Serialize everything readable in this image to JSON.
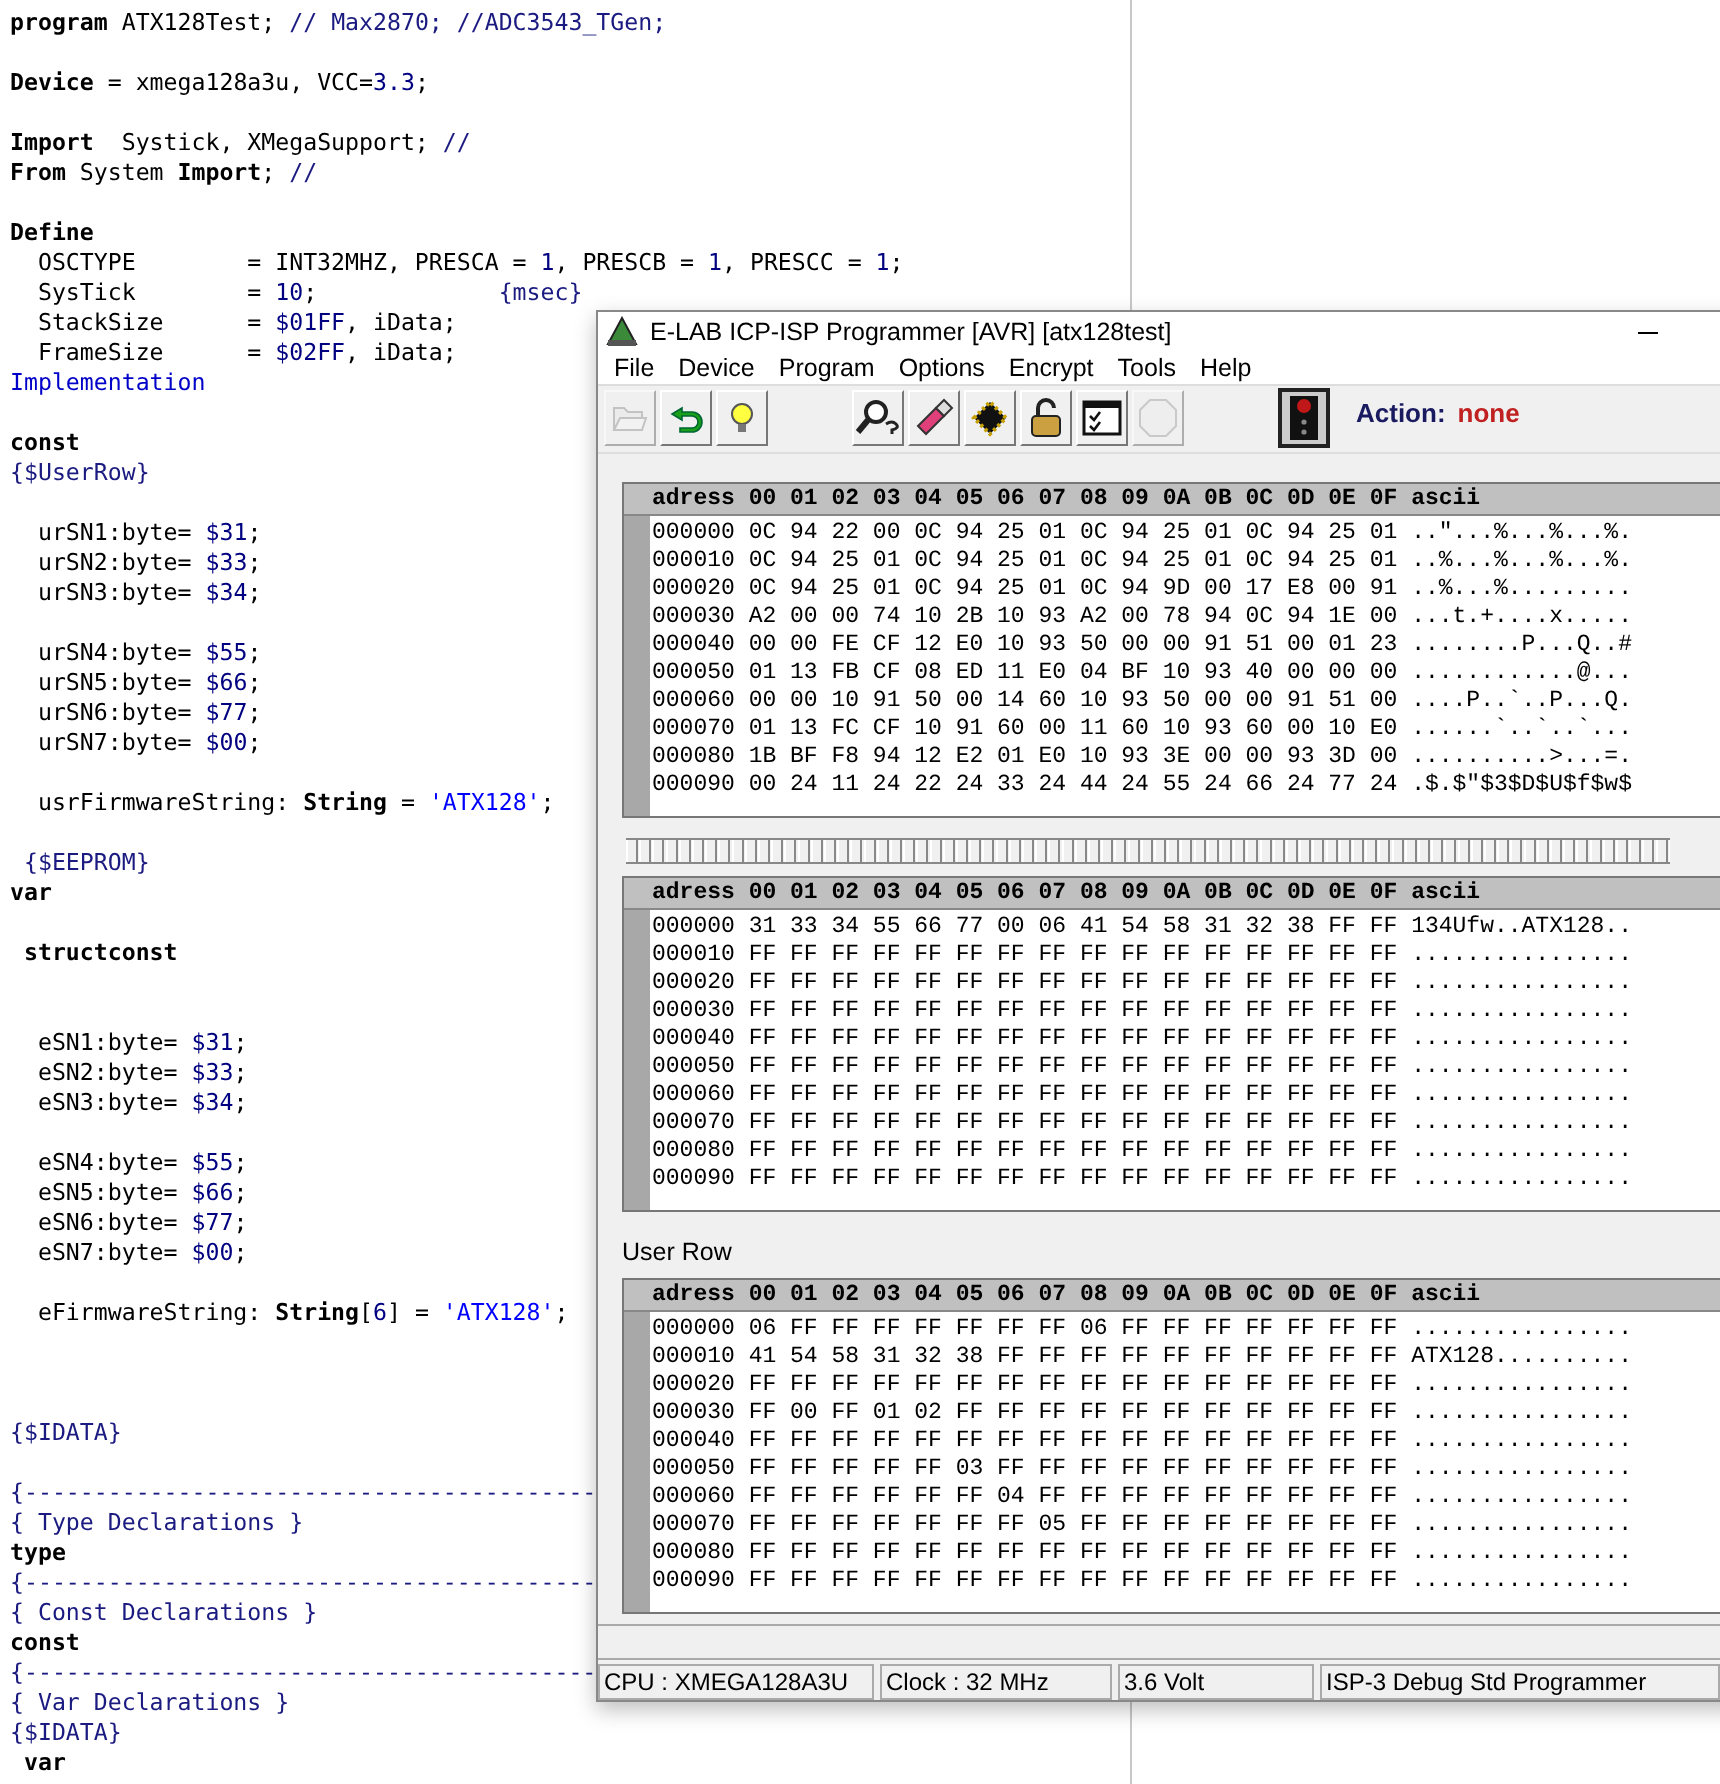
{
  "editor": {
    "lines": [
      {
        "kind": "code",
        "segments": [
          {
            "kind": "kw",
            "text": "program"
          },
          {
            "kind": "plain",
            "text": " ATX128Test; "
          },
          {
            "kind": "comment",
            "text": "// Max2870; //ADC3543_TGen;"
          }
        ]
      },
      {
        "kind": "blank"
      },
      {
        "kind": "code",
        "segments": [
          {
            "kind": "kw",
            "text": "Device"
          },
          {
            "kind": "plain",
            "text": " = xmega128a3u, VCC="
          },
          {
            "kind": "num",
            "text": "3.3"
          },
          {
            "kind": "plain",
            "text": ";"
          }
        ]
      },
      {
        "kind": "blank"
      },
      {
        "kind": "code",
        "segments": [
          {
            "kind": "kw",
            "text": "Import"
          },
          {
            "kind": "plain",
            "text": "  Systick, XMegaSupport; "
          },
          {
            "kind": "comment",
            "text": "//"
          }
        ]
      },
      {
        "kind": "code",
        "segments": [
          {
            "kind": "kw",
            "text": "From"
          },
          {
            "kind": "plain",
            "text": " System "
          },
          {
            "kind": "kw",
            "text": "Import"
          },
          {
            "kind": "plain",
            "text": "; "
          },
          {
            "kind": "comment",
            "text": "//"
          }
        ]
      },
      {
        "kind": "blank"
      },
      {
        "kind": "code",
        "segments": [
          {
            "kind": "kw",
            "text": "Define"
          }
        ]
      },
      {
        "kind": "code",
        "segments": [
          {
            "kind": "plain",
            "text": "  OSCTYPE        = INT32MHZ, PRESCA = "
          },
          {
            "kind": "num",
            "text": "1"
          },
          {
            "kind": "plain",
            "text": ", PRESCB = "
          },
          {
            "kind": "num",
            "text": "1"
          },
          {
            "kind": "plain",
            "text": ", PRESCC = "
          },
          {
            "kind": "num",
            "text": "1"
          },
          {
            "kind": "plain",
            "text": ";"
          }
        ]
      },
      {
        "kind": "code",
        "segments": [
          {
            "kind": "plain",
            "text": "  SysTick        = "
          },
          {
            "kind": "num",
            "text": "10"
          },
          {
            "kind": "plain",
            "text": ";             "
          },
          {
            "kind": "comment",
            "text": "{msec}"
          }
        ]
      },
      {
        "kind": "code",
        "segments": [
          {
            "kind": "plain",
            "text": "  StackSize      = "
          },
          {
            "kind": "num",
            "text": "$01FF"
          },
          {
            "kind": "plain",
            "text": ", iData;"
          }
        ]
      },
      {
        "kind": "code",
        "segments": [
          {
            "kind": "plain",
            "text": "  FrameSize      = "
          },
          {
            "kind": "num",
            "text": "$02FF"
          },
          {
            "kind": "plain",
            "text": ", iData;"
          }
        ]
      },
      {
        "kind": "code",
        "segments": [
          {
            "kind": "dir",
            "text": "Implementation"
          }
        ]
      },
      {
        "kind": "blank"
      },
      {
        "kind": "code",
        "segments": [
          {
            "kind": "kw",
            "text": "const"
          }
        ]
      },
      {
        "kind": "code",
        "segments": [
          {
            "kind": "comment",
            "text": "{$UserRow}"
          }
        ]
      },
      {
        "kind": "blank"
      },
      {
        "kind": "code",
        "segments": [
          {
            "kind": "plain",
            "text": "  urSN1:byte= "
          },
          {
            "kind": "num",
            "text": "$31"
          },
          {
            "kind": "plain",
            "text": ";"
          }
        ]
      },
      {
        "kind": "code",
        "segments": [
          {
            "kind": "plain",
            "text": "  urSN2:byte= "
          },
          {
            "kind": "num",
            "text": "$33"
          },
          {
            "kind": "plain",
            "text": ";"
          }
        ]
      },
      {
        "kind": "code",
        "segments": [
          {
            "kind": "plain",
            "text": "  urSN3:byte= "
          },
          {
            "kind": "num",
            "text": "$34"
          },
          {
            "kind": "plain",
            "text": ";"
          }
        ]
      },
      {
        "kind": "blank"
      },
      {
        "kind": "code",
        "segments": [
          {
            "kind": "plain",
            "text": "  urSN4:byte= "
          },
          {
            "kind": "num",
            "text": "$55"
          },
          {
            "kind": "plain",
            "text": ";"
          }
        ]
      },
      {
        "kind": "code",
        "segments": [
          {
            "kind": "plain",
            "text": "  urSN5:byte= "
          },
          {
            "kind": "num",
            "text": "$66"
          },
          {
            "kind": "plain",
            "text": ";"
          }
        ]
      },
      {
        "kind": "code",
        "segments": [
          {
            "kind": "plain",
            "text": "  urSN6:byte= "
          },
          {
            "kind": "num",
            "text": "$77"
          },
          {
            "kind": "plain",
            "text": ";"
          }
        ]
      },
      {
        "kind": "code",
        "segments": [
          {
            "kind": "plain",
            "text": "  urSN7:byte= "
          },
          {
            "kind": "num",
            "text": "$00"
          },
          {
            "kind": "plain",
            "text": ";"
          }
        ]
      },
      {
        "kind": "blank"
      },
      {
        "kind": "code",
        "segments": [
          {
            "kind": "plain",
            "text": "  usrFirmwareString: "
          },
          {
            "kind": "kw",
            "text": "String"
          },
          {
            "kind": "plain",
            "text": " = "
          },
          {
            "kind": "str",
            "text": "'ATX128'"
          },
          {
            "kind": "plain",
            "text": ";"
          }
        ]
      },
      {
        "kind": "blank"
      },
      {
        "kind": "code",
        "segments": [
          {
            "kind": "comment",
            "text": " {$EEPROM}"
          }
        ]
      },
      {
        "kind": "code",
        "segments": [
          {
            "kind": "kw",
            "text": "var"
          }
        ]
      },
      {
        "kind": "blank"
      },
      {
        "kind": "code",
        "segments": [
          {
            "kind": "kw",
            "text": " structconst"
          }
        ]
      },
      {
        "kind": "blank"
      },
      {
        "kind": "blank"
      },
      {
        "kind": "code",
        "segments": [
          {
            "kind": "plain",
            "text": "  eSN1:byte= "
          },
          {
            "kind": "num",
            "text": "$31"
          },
          {
            "kind": "plain",
            "text": ";"
          }
        ]
      },
      {
        "kind": "code",
        "segments": [
          {
            "kind": "plain",
            "text": "  eSN2:byte= "
          },
          {
            "kind": "num",
            "text": "$33"
          },
          {
            "kind": "plain",
            "text": ";"
          }
        ]
      },
      {
        "kind": "code",
        "segments": [
          {
            "kind": "plain",
            "text": "  eSN3:byte= "
          },
          {
            "kind": "num",
            "text": "$34"
          },
          {
            "kind": "plain",
            "text": ";"
          }
        ]
      },
      {
        "kind": "blank"
      },
      {
        "kind": "code",
        "segments": [
          {
            "kind": "plain",
            "text": "  eSN4:byte= "
          },
          {
            "kind": "num",
            "text": "$55"
          },
          {
            "kind": "plain",
            "text": ";"
          }
        ]
      },
      {
        "kind": "code",
        "segments": [
          {
            "kind": "plain",
            "text": "  eSN5:byte= "
          },
          {
            "kind": "num",
            "text": "$66"
          },
          {
            "kind": "plain",
            "text": ";"
          }
        ]
      },
      {
        "kind": "code",
        "segments": [
          {
            "kind": "plain",
            "text": "  eSN6:byte= "
          },
          {
            "kind": "num",
            "text": "$77"
          },
          {
            "kind": "plain",
            "text": ";"
          }
        ]
      },
      {
        "kind": "code",
        "segments": [
          {
            "kind": "plain",
            "text": "  eSN7:byte= "
          },
          {
            "kind": "num",
            "text": "$00"
          },
          {
            "kind": "plain",
            "text": ";"
          }
        ]
      },
      {
        "kind": "blank"
      },
      {
        "kind": "code",
        "segments": [
          {
            "kind": "plain",
            "text": "  eFirmwareString: "
          },
          {
            "kind": "kw",
            "text": "String"
          },
          {
            "kind": "plain",
            "text": "["
          },
          {
            "kind": "num",
            "text": "6"
          },
          {
            "kind": "plain",
            "text": "] = "
          },
          {
            "kind": "str",
            "text": "'ATX128'"
          },
          {
            "kind": "plain",
            "text": ";"
          }
        ]
      },
      {
        "kind": "blank"
      },
      {
        "kind": "blank"
      },
      {
        "kind": "blank"
      },
      {
        "kind": "code",
        "segments": [
          {
            "kind": "comment",
            "text": "{$IDATA}"
          }
        ]
      },
      {
        "kind": "blank"
      },
      {
        "kind": "code",
        "segments": [
          {
            "kind": "comment",
            "text": "{-----------------------------------------"
          }
        ]
      },
      {
        "kind": "code",
        "segments": [
          {
            "kind": "comment",
            "text": "{ Type Declarations }"
          }
        ]
      },
      {
        "kind": "code",
        "segments": [
          {
            "kind": "kw",
            "text": "type"
          }
        ]
      },
      {
        "kind": "code",
        "segments": [
          {
            "kind": "comment",
            "text": "{-----------------------------------------"
          }
        ]
      },
      {
        "kind": "code",
        "segments": [
          {
            "kind": "comment",
            "text": "{ Const Declarations }"
          }
        ]
      },
      {
        "kind": "code",
        "segments": [
          {
            "kind": "kw",
            "text": "const"
          }
        ]
      },
      {
        "kind": "code",
        "segments": [
          {
            "kind": "comment",
            "text": "{-----------------------------------------"
          }
        ]
      },
      {
        "kind": "code",
        "segments": [
          {
            "kind": "comment",
            "text": "{ Var Declarations }"
          }
        ]
      },
      {
        "kind": "code",
        "segments": [
          {
            "kind": "comment",
            "text": "{$IDATA}"
          }
        ]
      },
      {
        "kind": "code",
        "segments": [
          {
            "kind": "kw",
            "text": " var"
          }
        ]
      }
    ]
  },
  "window": {
    "title": "E-LAB ICP-ISP Programmer [AVR]  [atx128test]",
    "menu": [
      "File",
      "Device",
      "Program",
      "Options",
      "Encrypt",
      "Tools",
      "Help"
    ],
    "toolbar": [
      {
        "kind": "open",
        "disabled": true
      },
      {
        "kind": "undo",
        "disabled": false
      },
      {
        "kind": "bulb",
        "disabled": false
      },
      {
        "kind": "gap"
      },
      {
        "kind": "search",
        "disabled": false
      },
      {
        "kind": "eraser",
        "disabled": false
      },
      {
        "kind": "chip",
        "disabled": false
      },
      {
        "kind": "lock",
        "disabled": false
      },
      {
        "kind": "checklist",
        "disabled": false
      },
      {
        "kind": "stop",
        "disabled": true
      }
    ],
    "action": {
      "label": "Action:",
      "value": "none"
    },
    "panels": [
      {
        "columns": [
          "adress",
          "00",
          "01",
          "02",
          "03",
          "04",
          "05",
          "06",
          "07",
          "08",
          "09",
          "0A",
          "0B",
          "0C",
          "0D",
          "0E",
          "0F",
          "ascii"
        ],
        "rows": [
          {
            "address": "000000",
            "bytes": "0C 94 22 00 0C 94 25 01 0C 94 25 01 0C 94 25 01",
            "ascii": "..\"...%...%...%."
          },
          {
            "address": "000010",
            "bytes": "0C 94 25 01 0C 94 25 01 0C 94 25 01 0C 94 25 01",
            "ascii": "..%...%...%...%."
          },
          {
            "address": "000020",
            "bytes": "0C 94 25 01 0C 94 25 01 0C 94 9D 00 17 E8 00 91",
            "ascii": "..%...%........."
          },
          {
            "address": "000030",
            "bytes": "A2 00 00 74 10 2B 10 93 A2 00 78 94 0C 94 1E 00",
            "ascii": "...t.+....x....."
          },
          {
            "address": "000040",
            "bytes": "00 00 FE CF 12 E0 10 93 50 00 00 91 51 00 01 23",
            "ascii": "........P...Q..#"
          },
          {
            "address": "000050",
            "bytes": "01 13 FB CF 08 ED 11 E0 04 BF 10 93 40 00 00 00",
            "ascii": "............@..."
          },
          {
            "address": "000060",
            "bytes": "00 00 10 91 50 00 14 60 10 93 50 00 00 91 51 00",
            "ascii": "....P..`..P...Q."
          },
          {
            "address": "000070",
            "bytes": "01 13 FC CF 10 91 60 00 11 60 10 93 60 00 10 E0",
            "ascii": "......`..`..`..."
          },
          {
            "address": "000080",
            "bytes": "1B BF F8 94 12 E2 01 E0 10 93 3E 00 00 93 3D 00",
            "ascii": "..........>...=."
          },
          {
            "address": "000090",
            "bytes": "00 24 11 24 22 24 33 24 44 24 55 24 66 24 77 24",
            "ascii": ".$.$\"$3$D$U$f$w$"
          }
        ]
      },
      {
        "columns": [
          "adress",
          "00",
          "01",
          "02",
          "03",
          "04",
          "05",
          "06",
          "07",
          "08",
          "09",
          "0A",
          "0B",
          "0C",
          "0D",
          "0E",
          "0F",
          "ascii"
        ],
        "rows": [
          {
            "address": "000000",
            "bytes": "31 33 34 55 66 77 00 06 41 54 58 31 32 38 FF FF",
            "ascii": "134Ufw..ATX128.."
          },
          {
            "address": "000010",
            "bytes": "FF FF FF FF FF FF FF FF FF FF FF FF FF FF FF FF",
            "ascii": "................"
          },
          {
            "address": "000020",
            "bytes": "FF FF FF FF FF FF FF FF FF FF FF FF FF FF FF FF",
            "ascii": "................"
          },
          {
            "address": "000030",
            "bytes": "FF FF FF FF FF FF FF FF FF FF FF FF FF FF FF FF",
            "ascii": "................"
          },
          {
            "address": "000040",
            "bytes": "FF FF FF FF FF FF FF FF FF FF FF FF FF FF FF FF",
            "ascii": "................"
          },
          {
            "address": "000050",
            "bytes": "FF FF FF FF FF FF FF FF FF FF FF FF FF FF FF FF",
            "ascii": "................"
          },
          {
            "address": "000060",
            "bytes": "FF FF FF FF FF FF FF FF FF FF FF FF FF FF FF FF",
            "ascii": "................"
          },
          {
            "address": "000070",
            "bytes": "FF FF FF FF FF FF FF FF FF FF FF FF FF FF FF FF",
            "ascii": "................"
          },
          {
            "address": "000080",
            "bytes": "FF FF FF FF FF FF FF FF FF FF FF FF FF FF FF FF",
            "ascii": "................"
          },
          {
            "address": "000090",
            "bytes": "FF FF FF FF FF FF FF FF FF FF FF FF FF FF FF FF",
            "ascii": "................"
          }
        ]
      },
      {
        "label": "User Row",
        "columns": [
          "adress",
          "00",
          "01",
          "02",
          "03",
          "04",
          "05",
          "06",
          "07",
          "08",
          "09",
          "0A",
          "0B",
          "0C",
          "0D",
          "0E",
          "0F",
          "ascii"
        ],
        "rows": [
          {
            "address": "000000",
            "bytes": "06 FF FF FF FF FF FF FF 06 FF FF FF FF FF FF FF",
            "ascii": "................"
          },
          {
            "address": "000010",
            "bytes": "41 54 58 31 32 38 FF FF FF FF FF FF FF FF FF FF",
            "ascii": "ATX128.........."
          },
          {
            "address": "000020",
            "bytes": "FF FF FF FF FF FF FF FF FF FF FF FF FF FF FF FF",
            "ascii": "................"
          },
          {
            "address": "000030",
            "bytes": "FF 00 FF 01 02 FF FF FF FF FF FF FF FF FF FF FF",
            "ascii": "................"
          },
          {
            "address": "000040",
            "bytes": "FF FF FF FF FF FF FF FF FF FF FF FF FF FF FF FF",
            "ascii": "................"
          },
          {
            "address": "000050",
            "bytes": "FF FF FF FF FF 03 FF FF FF FF FF FF FF FF FF FF",
            "ascii": "................"
          },
          {
            "address": "000060",
            "bytes": "FF FF FF FF FF FF 04 FF FF FF FF FF FF FF FF FF",
            "ascii": "................"
          },
          {
            "address": "000070",
            "bytes": "FF FF FF FF FF FF FF 05 FF FF FF FF FF FF FF FF",
            "ascii": "................"
          },
          {
            "address": "000080",
            "bytes": "FF FF FF FF FF FF FF FF FF FF FF FF FF FF FF FF",
            "ascii": "................"
          },
          {
            "address": "000090",
            "bytes": "FF FF FF FF FF FF FF FF FF FF FF FF FF FF FF FF",
            "ascii": "................"
          }
        ]
      }
    ],
    "status_bar": [
      "CPU : XMEGA128A3U",
      "Clock : 32 MHz",
      "3.6 Volt",
      "ISP-3 Debug Std Programmer"
    ]
  }
}
